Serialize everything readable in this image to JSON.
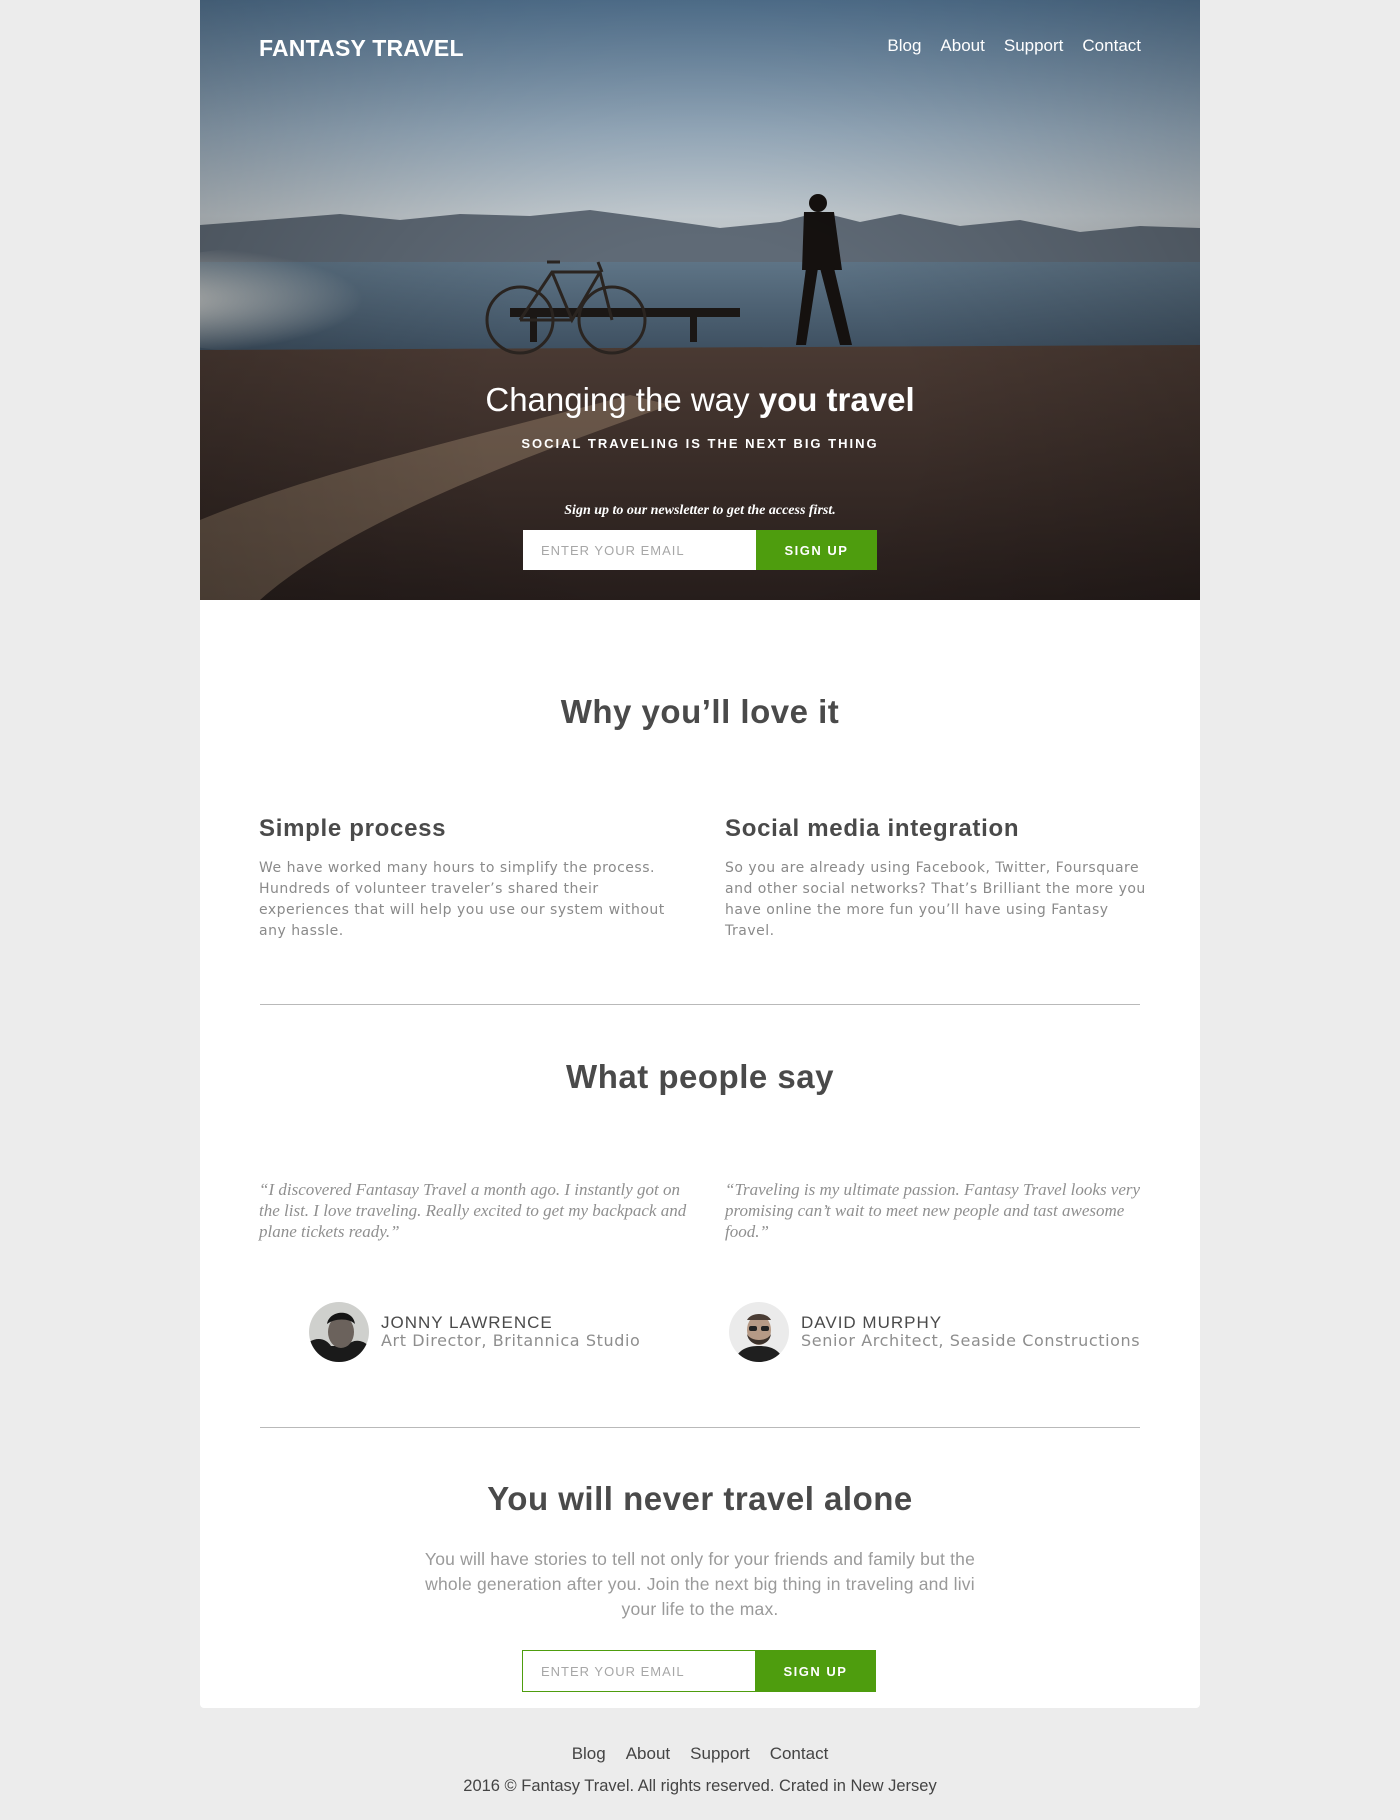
{
  "brand": {
    "name": "FANTASY TRAVEL"
  },
  "nav": {
    "items": [
      "Blog",
      "About",
      "Support",
      "Contact"
    ]
  },
  "hero": {
    "title_light": "Changing the way",
    "title_bold": "you travel",
    "subtitle": "SOCIAL TRAVELING IS THE NEXT BIG THING",
    "note": "Sign up to our newsletter to get the access first.",
    "email_placeholder": "ENTER YOUR EMAIL",
    "signup_label": "SIGN UP"
  },
  "features": {
    "heading": "Why you’ll love it",
    "items": [
      {
        "title": "Simple process",
        "text": "We have worked many hours to simplify the process. Hundreds of volunteer traveler’s shared their experiences that will help you use our system without any hassle."
      },
      {
        "title": "Social media integration",
        "text": "So you are already using Facebook, Twitter, Foursquare and other social networks? That’s Brilliant the more you have online the more fun you’ll have using Fantasy Travel."
      }
    ]
  },
  "testimonials": {
    "heading": "What people say",
    "items": [
      {
        "quote": "“I discovered Fantasay Travel a month ago. I instantly got on the list. I love traveling. Really excited to get my backpack and plane tickets ready.”",
        "name": "JONNY LAWRENCE",
        "role": "Art Director, Britannica Studio"
      },
      {
        "quote": "“Traveling is my ultimate passion. Fantasy Travel looks very promising can’t wait to meet new people and tast awesome food.”",
        "name": "DAVID MURPHY",
        "role": "Senior Architect, Seaside Constructions"
      }
    ]
  },
  "closing": {
    "heading": "You will never travel alone",
    "text": "You will have stories to tell not only for your friends and family but the whole generation after you. Join the next big thing in traveling and livi your life to the max.",
    "email_placeholder": "ENTER YOUR EMAIL",
    "signup_label": "SIGN UP"
  },
  "footer": {
    "nav": [
      "Blog",
      "About",
      "Support",
      "Contact"
    ],
    "copyright": "2016 © Fantasy Travel. All rights reserved. Crated in New Jersey"
  },
  "colors": {
    "accent": "#4e9d0e",
    "page_bg": "#ececec",
    "text": "#4a4a4a",
    "muted": "#8a8a8a"
  }
}
